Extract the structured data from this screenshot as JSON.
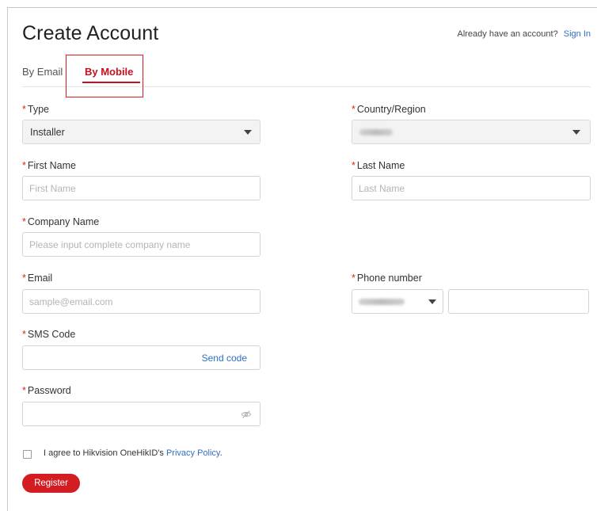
{
  "header": {
    "title": "Create Account",
    "have_account_text": "Already have an account?",
    "sign_in_label": "Sign In"
  },
  "tabs": [
    {
      "label": "By Email",
      "active": false
    },
    {
      "label": "By Mobile",
      "active": true
    }
  ],
  "form": {
    "required_mark": "*",
    "type": {
      "label": "Type",
      "value": "Installer"
    },
    "country": {
      "label": "Country/Region",
      "value": ""
    },
    "first_name": {
      "label": "First Name",
      "placeholder": "First Name",
      "value": ""
    },
    "last_name": {
      "label": "Last Name",
      "placeholder": "Last Name",
      "value": ""
    },
    "company_name": {
      "label": "Company Name",
      "placeholder": "Please input complete company name",
      "value": ""
    },
    "email": {
      "label": "Email",
      "placeholder": "sample@email.com",
      "value": ""
    },
    "phone": {
      "label": "Phone number",
      "country_code": "",
      "value": ""
    },
    "sms_code": {
      "label": "SMS Code",
      "value": "",
      "send_label": "Send code"
    },
    "password": {
      "label": "Password",
      "value": ""
    },
    "agree": {
      "prefix": "I agree to Hikvision OneHikID's",
      "link": "Privacy Policy",
      "suffix": ".",
      "checked": false
    },
    "register_label": "Register"
  },
  "icons": {
    "dropdown": "caret-down-icon",
    "password_toggle": "eye-slash-icon",
    "checkbox": "checkbox-icon"
  },
  "colors": {
    "accent": "#c8101e",
    "link": "#2f6fc7",
    "required": "#d9261c",
    "button_bg": "#d31d23",
    "highlight_border": "#e01b1b"
  }
}
